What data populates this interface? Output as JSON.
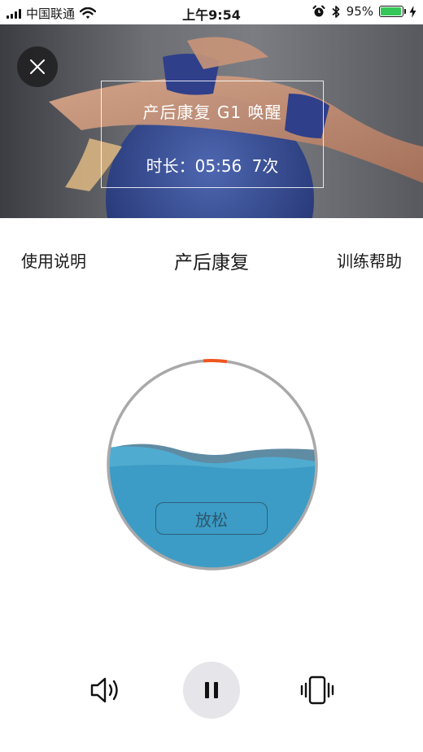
{
  "status_bar": {
    "carrier": "中国联通",
    "time": "上午9:54",
    "battery": "95%",
    "battery_level": 0.95
  },
  "session": {
    "title": "产后康复  G1  唤醒",
    "meta": "时长：05:56  7次"
  },
  "nav": {
    "left_label": "使用说明",
    "title": "产后康复",
    "right_label": "训练帮助"
  },
  "gauge": {
    "state_label": "放松",
    "accent_color": "#f0561f",
    "water_color": "#3c9cc5"
  },
  "icons": {
    "close": "close-icon",
    "speaker": "speaker-icon",
    "pause": "pause-icon",
    "vibrate": "vibrate-icon"
  }
}
